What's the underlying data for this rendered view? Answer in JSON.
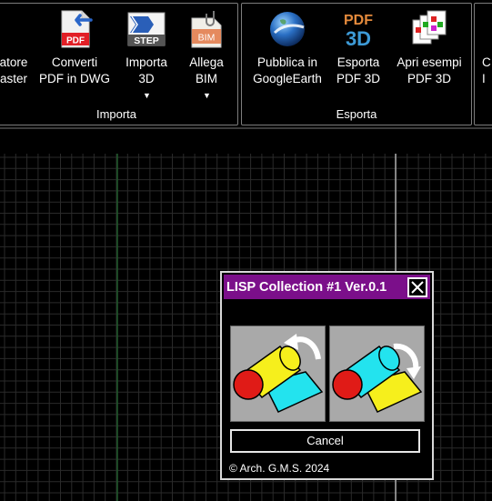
{
  "ribbon": {
    "import_panel": {
      "title": "Importa",
      "tools": [
        {
          "line1": "atore",
          "line2": "aster",
          "icon": "raster-icon"
        },
        {
          "line1": "Converti",
          "line2": "PDF in DWG",
          "icon": "pdf-import-icon",
          "icon_text": "PDF"
        },
        {
          "line1": "Importa",
          "line2": "3D",
          "icon": "step-import-icon",
          "icon_text": "STEP"
        },
        {
          "line1": "Allega",
          "line2": "BIM",
          "icon": "bim-attach-icon",
          "icon_text": "BIM"
        }
      ]
    },
    "export_panel": {
      "title": "Esporta",
      "tools": [
        {
          "line1": "Pubblica in",
          "line2": "GoogleEarth",
          "icon": "google-earth-icon"
        },
        {
          "line1": "Esporta",
          "line2": "PDF 3D",
          "icon": "pdf3d-export-icon",
          "icon_text_top": "PDF",
          "icon_text_bottom": "3D"
        },
        {
          "line1": "Apri esempi",
          "line2": "PDF 3D",
          "icon": "sample-files-icon"
        }
      ]
    },
    "next_panel": {
      "line1": "C",
      "line2": "I"
    }
  },
  "dialog": {
    "title": "LISP Collection #1 Ver.0.1",
    "cancel_label": "Cancel",
    "copyright": "© Arch. G.M.S. 2024",
    "left_button_icon": "rotate-counterclockwise-icon",
    "right_button_icon": "rotate-clockwise-icon"
  },
  "colors": {
    "title_bar": "#7b0f8a",
    "grid": "#2a2a2a",
    "axis_y": "#1f5a2a",
    "crosshair": "#cfcfcf"
  }
}
